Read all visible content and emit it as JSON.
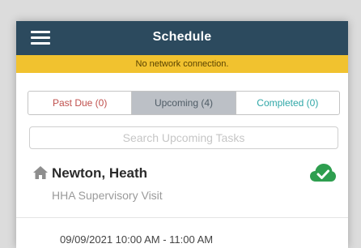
{
  "header": {
    "title": "Schedule",
    "menu_icon": "hamburger-menu-icon"
  },
  "banner": {
    "text": "No network connection."
  },
  "tabs": [
    {
      "label": "Past Due (0)",
      "color": "#c0504d"
    },
    {
      "label": "Upcoming (4)",
      "color": "#4f5c66",
      "selected": true
    },
    {
      "label": "Completed (0)",
      "color": "#2fa7a7"
    }
  ],
  "search": {
    "placeholder": "Search Upcoming Tasks",
    "value": ""
  },
  "task": {
    "icon": "home-icon",
    "name": "Newton, Heath",
    "visit_type": "HHA Supervisory Visit",
    "status_icon": "cloud-check-icon",
    "status_color": "#2e9e4f"
  },
  "next_task": {
    "datetime": "09/09/2021  10:00 AM - 11:00 AM"
  },
  "colors": {
    "header_bg": "#2c4a5e",
    "banner_bg": "#f1c22f",
    "selected_tab_bg": "#bcc0c6"
  }
}
